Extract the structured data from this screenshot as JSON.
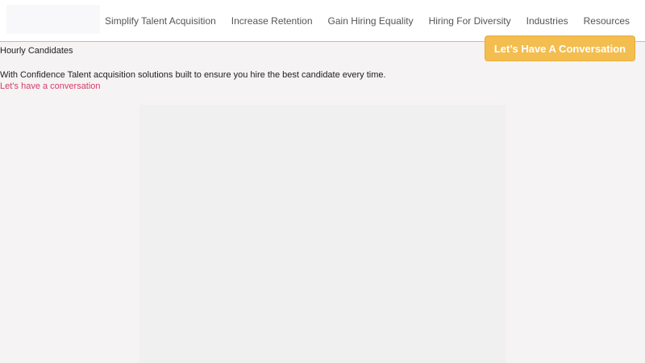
{
  "header": {
    "nav": [
      "Simplify Talent Acquisition",
      "Increase Retention",
      "Gain Hiring Equality",
      "Hiring For Diversity",
      "Industries",
      "Resources"
    ],
    "cta_label": "Let’s Have A Conversation"
  },
  "main": {
    "title": "Hourly Candidates",
    "tagline": "With Confidence Talent acquisition solutions built to ensure you hire the best candidate every time.",
    "link_label": "Let’s have a conversation"
  },
  "colors": {
    "accent": "#f4bd4f",
    "link": "#d63b6b",
    "background": "#f5f3f3"
  }
}
